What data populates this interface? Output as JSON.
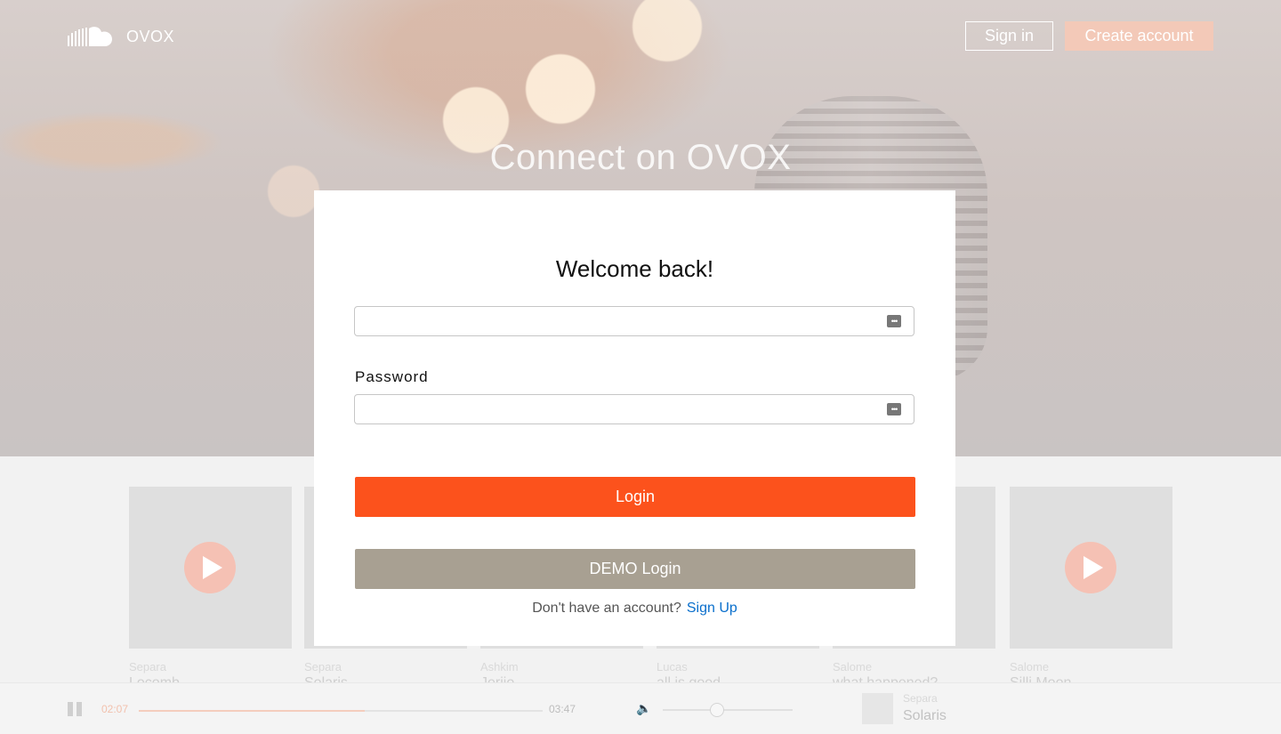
{
  "header": {
    "logo_text": "OVOX",
    "logo_icon": "soundcloud-cloud-icon",
    "signin_label": "Sign in",
    "create_label": "Create account"
  },
  "hero": {
    "title": "Connect on OVOX"
  },
  "tracks": [
    {
      "artist": "Separa",
      "title": "Locomb"
    },
    {
      "artist": "Separa",
      "title": "Solaris"
    },
    {
      "artist": "Ashkim",
      "title": "Jerijo"
    },
    {
      "artist": "Lucas",
      "title": "all is good"
    },
    {
      "artist": "Salome",
      "title": "what happened?"
    },
    {
      "artist": "Salome",
      "title": "Silli Moon"
    }
  ],
  "modal": {
    "title": "Welcome back!",
    "username_value": "",
    "password_label": "Password",
    "password_value": "",
    "login_label": "Login",
    "demo_label": "DEMO Login",
    "no_account_text": "Don't have an account?",
    "signup_label": "Sign Up"
  },
  "player": {
    "current_time": "02:07",
    "total_time": "03:47",
    "progress": 0.56,
    "volume": 0.41,
    "now_playing_artist": "Separa",
    "now_playing_title": "Solaris"
  },
  "colors": {
    "accent": "#fc521c",
    "demo": "#a8a092",
    "link": "#0a6fcc"
  }
}
